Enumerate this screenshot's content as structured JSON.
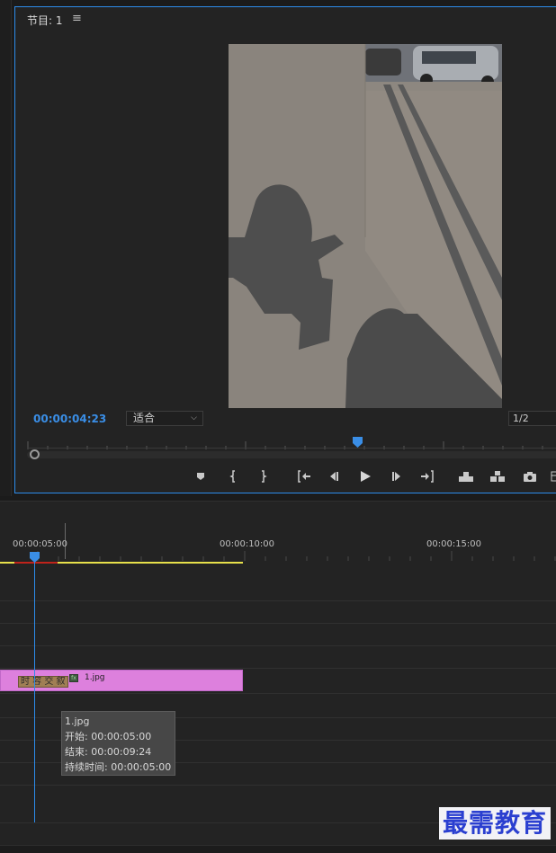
{
  "program_monitor": {
    "title": "节目: 1",
    "menu_icon": "hamburger-icon",
    "current_timecode": "00:00:04:23",
    "fit_select": {
      "value": "适合"
    },
    "resolution_select": {
      "value": "1/2"
    },
    "transport_icons": [
      "add-marker-icon",
      "mark-in-icon",
      "mark-out-icon",
      "go-to-in-icon",
      "step-back-icon",
      "play-icon",
      "step-forward-icon",
      "go-to-out-icon",
      "lift-icon",
      "extract-icon",
      "export-frame-icon",
      "more-icon"
    ],
    "accent": "#2d8ceb"
  },
  "timeline": {
    "ruler_labels": [
      "00:00:05:00",
      "00:00:10:00",
      "00:00:15:00"
    ],
    "clip": {
      "tag_label": "时 容 交 叙",
      "fx_label": "fx",
      "name": "1.jpg",
      "color": "#dd80dd"
    },
    "tooltip": {
      "name": "1.jpg",
      "start": "开始: 00:00:05:00",
      "end": "结束: 00:00:09:24",
      "duration": "持续时间: 00:00:05:00"
    }
  },
  "watermark": "最需教育"
}
